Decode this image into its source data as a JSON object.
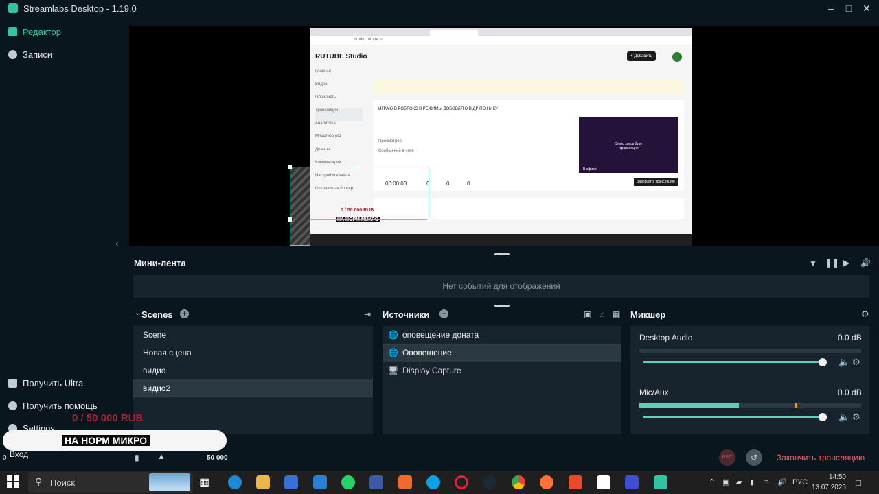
{
  "window": {
    "title": "Streamlabs Desktop - 1.19.0",
    "minimize_icon": "minimize-icon",
    "maximize_icon": "maximize-icon",
    "close_icon": "close-icon"
  },
  "sidebar": {
    "items": [
      {
        "label": "Редактор",
        "icon": "editor-icon",
        "active": true
      },
      {
        "label": "Записи",
        "icon": "recordings-icon",
        "active": false
      }
    ],
    "bottom": [
      {
        "label": "Получить Ultra",
        "icon": "ultra-icon"
      },
      {
        "label": "Получить помощь",
        "icon": "help-icon"
      },
      {
        "label": "Settings",
        "icon": "gear-icon"
      },
      {
        "label": "Вход",
        "icon": "login-icon"
      }
    ],
    "counter": "0"
  },
  "preview": {
    "browser_url": "studio.rutube.ru",
    "rutube_logo": "RUTUBE Studio",
    "add_button": "+ Добавить",
    "nav": [
      "Главная",
      "Видео",
      "Плейлисты",
      "Трансляции",
      "Аналитика",
      "Монетизация",
      "Донаты",
      "Комментарии",
      "Настройки канала",
      "Отправить в блогер"
    ],
    "stream_title": "ИГРАЮ В РОБЛОКС В РЕЖИМЫ ДОБОВЛЯЮ В ДР ПО НИКУ",
    "views_label": "Просмотров",
    "chat_label": "Сообщений в чате",
    "timer": "00:00:03",
    "likes": "0",
    "dislikes": "0",
    "comments": "0",
    "end_button": "Завершить трансляцию",
    "preview_caption": "Скоро здесь будет трансляция",
    "live_badge": "В эфире",
    "donation_small": "0 / 50 000 RUB",
    "micro_small": "НА НОРМ МИКРО"
  },
  "minifeed": {
    "title": "Мини-лента",
    "empty_text": "Нет событий для отображения"
  },
  "scenes": {
    "title": "Scenes",
    "items": [
      "Scene",
      "Новая сцена",
      "видио",
      "видио2"
    ],
    "selected_index": 3
  },
  "sources": {
    "title": "Источники",
    "items": [
      {
        "label": "оповещение доната",
        "icon": "globe-icon"
      },
      {
        "label": "Оповещение",
        "icon": "globe-icon"
      },
      {
        "label": "Display Capture",
        "icon": "monitor-icon"
      }
    ],
    "selected_index": 1
  },
  "mixer": {
    "title": "Микшер",
    "channels": [
      {
        "name": "Desktop Audio",
        "db": "0.0 dB",
        "meter_level": 0.0,
        "volume": 1.0
      },
      {
        "name": "Mic/Aux",
        "db": "0.0 dB",
        "meter_level": 0.45,
        "volume": 1.0
      }
    ]
  },
  "footer": {
    "rec_label": "REC",
    "end_stream": "Закончить трансляцию",
    "goal_value": "50 000"
  },
  "overlay": {
    "amount": "0 / 50 000 RUB",
    "micro": "НА НОРМ МИКРО"
  },
  "taskbar": {
    "search_placeholder": "Поиск",
    "lang": "РУС",
    "time": "14:50",
    "date": "13.07.2025"
  }
}
